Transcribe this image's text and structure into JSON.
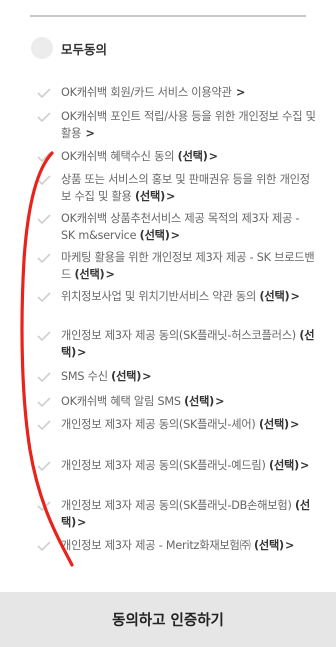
{
  "all_agree": {
    "label": "모두동의"
  },
  "items": [
    {
      "text": "OK캐쉬백 회원/카드 서비스 이용약관",
      "optional": "",
      "chevron": ">"
    },
    {
      "text": "OK캐쉬백 포인트 적립/사용 등을 위한 개인정보 수집 및 활용",
      "optional": "",
      "chevron": ">"
    },
    {
      "text": "OK캐쉬백 혜택수신 동의 ",
      "optional": "(선택)",
      "chevron": ">"
    },
    {
      "text": "상품 또는 서비스의 홍보 및 판매권유 등을 위한 개인정보 수집 및 활용 ",
      "optional": "(선택)",
      "chevron": ">"
    },
    {
      "text": "OK캐쉬백 상품추천서비스 제공 목적의 제3자 제공 - SK m&service ",
      "optional": "(선택)",
      "chevron": ">"
    },
    {
      "text": "마케팅 활용을 위한 개인정보 제3자 제공 - SK 브로드밴드 ",
      "optional": "(선택)",
      "chevron": ">"
    },
    {
      "text": "위치정보사업 및 위치기반서비스 약관 동의 ",
      "optional": "(선택)",
      "chevron": ">"
    },
    {
      "text": "개인정보 제3자 제공 동의(SK플래닛-허스코플러스) ",
      "optional": "(선택)",
      "chevron": ">"
    },
    {
      "text": "SMS 수신 ",
      "optional": "(선택)",
      "chevron": ">"
    },
    {
      "text": "OK캐쉬백 혜택 알림 SMS ",
      "optional": "(선택)",
      "chevron": ">"
    },
    {
      "text": "개인정보 제3자 제공 동의(SK플래닛-셰어) ",
      "optional": "(선택)",
      "chevron": ">"
    },
    {
      "text": "개인정보 제3자 제공 동의(SK플래닛-예드림) ",
      "optional": "(선택)",
      "chevron": ">"
    },
    {
      "text": "개인정보 제3자 제공 동의(SK플래닛-DB손해보험) ",
      "optional": "(선택)",
      "chevron": ">"
    },
    {
      "text": "개인정보 제3자 제공 - Meritz화재보험㈜ ",
      "optional": "(선택)",
      "chevron": ">"
    }
  ],
  "submit": {
    "label": "동의하고 인증하기"
  },
  "colors": {
    "annotation_stroke": "#e8231b",
    "check": "#cfcfcf",
    "bottom_bar": "#e6e6e6"
  }
}
